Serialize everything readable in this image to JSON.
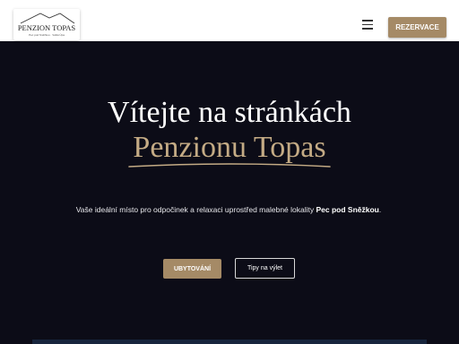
{
  "header": {
    "logo": {
      "title": "PENZION TOPAS",
      "tagline": "Pec pod Sněžkou · Velká Úpa"
    },
    "menu_icon": "hamburger-menu-icon",
    "reserve_label": "REZERVACE"
  },
  "hero": {
    "title": "Vítejte na stránkách",
    "subtitle": "Penzionu Topas",
    "intro_text": "Vaše ideální místo pro odpočinek a relaxaci uprostřed malebné lokality ",
    "intro_bold": "Pec pod Sněžkou",
    "intro_end": ".",
    "buttons": {
      "accommodation": "UBYTOVÁNÍ",
      "trips": "Tipy na výlet"
    }
  },
  "colors": {
    "background": "#0c0c17",
    "accent": "#a58a66",
    "subtitle": "#c4ab85",
    "header_bg": "#ffffff"
  }
}
